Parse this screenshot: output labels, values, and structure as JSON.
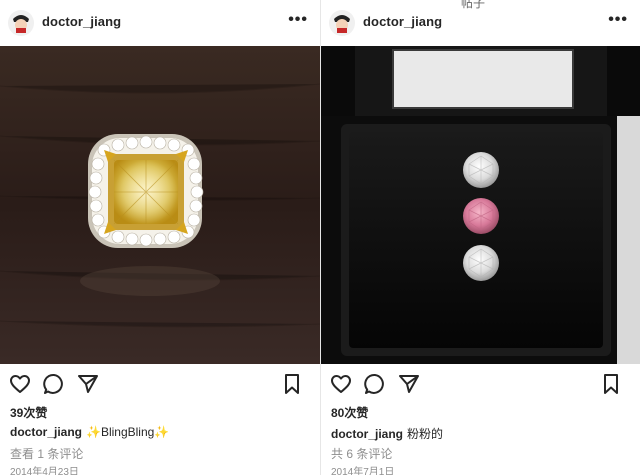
{
  "posts": [
    {
      "username": "doctor_jiang",
      "more_label": "•••",
      "likes": "39次赞",
      "caption_user": "doctor_jiang",
      "caption_text": "✨BlingBling✨",
      "comments": "查看 1 条评论",
      "date": "2014年4月23日"
    },
    {
      "username": "doctor_jiang",
      "more_label": "•••",
      "top_fragment": "帖子",
      "likes": "80次赞",
      "caption_user": "doctor_jiang",
      "caption_text": "粉粉的",
      "comments": "共 6 条评论",
      "date": "2014年7月1日"
    }
  ],
  "icons": {
    "like": "heart-icon",
    "comment": "comment-icon",
    "share": "share-icon",
    "save": "bookmark-icon"
  },
  "colors": {
    "text": "#262626",
    "muted": "#8e8e8e",
    "ring_gold": "#d8a51c",
    "ring_yellow_stone": "#e7cf62",
    "pink_stone": "#d87a9a",
    "box_black": "#111111"
  }
}
